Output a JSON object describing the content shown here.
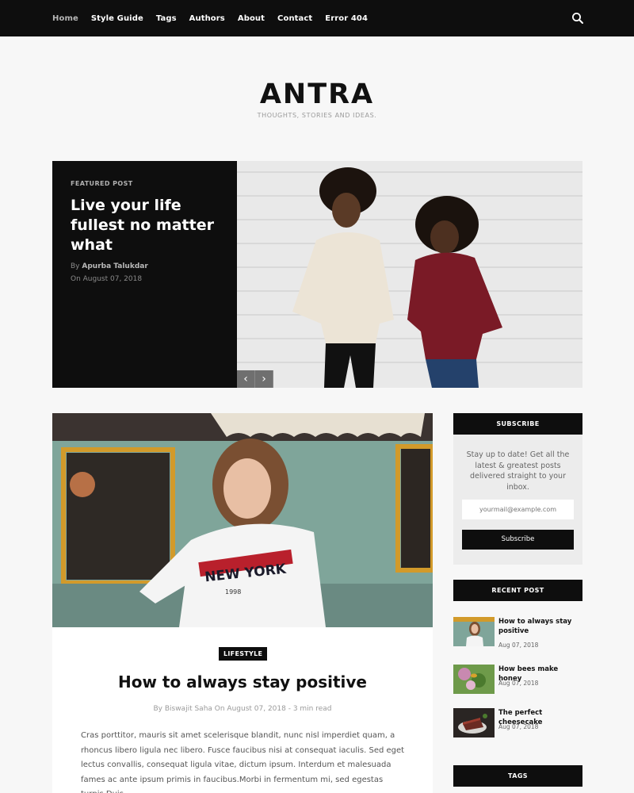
{
  "nav": {
    "items": [
      {
        "label": "Home",
        "active": true
      },
      {
        "label": "Style Guide",
        "active": false
      },
      {
        "label": "Tags",
        "active": false
      },
      {
        "label": "Authors",
        "active": false
      },
      {
        "label": "About",
        "active": false
      },
      {
        "label": "Contact",
        "active": false
      },
      {
        "label": "Error 404",
        "active": false
      }
    ],
    "search_icon": "search-icon"
  },
  "brand": {
    "logo": "ANTRA",
    "tagline": "THOUGHTS, STORIES AND IDEAS."
  },
  "featured": {
    "label": "FEATURED POST",
    "title": "Live your life fullest no matter what",
    "author_prefix": "By",
    "author": "Apurba Talukdar",
    "date": "On August 07, 2018",
    "prev_icon": "chevron-left-icon",
    "next_icon": "chevron-right-icon"
  },
  "article": {
    "category": "LIFESTYLE",
    "title": "How to always stay positive",
    "meta": "By Biswajit Saha On August 07, 2018 - 3 min read",
    "excerpt": "Cras porttitor, mauris sit amet scelerisque blandit, nunc nisl imperdiet quam, a rhoncus libero ligula nec libero. Fusce faucibus nisi at consequat iaculis. Sed eget lectus convallis, consequat ligula vitae, dictum ipsum. Interdum et malesuada fames ac ante ipsum primis in faucibus.Morbi in fermentum mi, sed egestas turpis.Duis"
  },
  "sidebar": {
    "subscribe": {
      "heading": "SUBSCRIBE",
      "description": "Stay up to date! Get all the latest & greatest posts delivered straight to your inbox.",
      "email_placeholder": "yourmail@example.com",
      "button": "Subscribe"
    },
    "recent": {
      "heading": "RECENT POST",
      "items": [
        {
          "title": "How to always stay positive",
          "date": "Aug 07, 2018"
        },
        {
          "title": "How bees make honey",
          "date": "Aug 07, 2018"
        },
        {
          "title": "The perfect cheesecake",
          "date": "Aug 07, 2018"
        }
      ]
    },
    "tags": {
      "heading": "TAGS"
    }
  },
  "colors": {
    "nav_bg": "#0e0e0e",
    "page_bg": "#f7f7f7",
    "accent_dark": "#0e0e0e"
  }
}
